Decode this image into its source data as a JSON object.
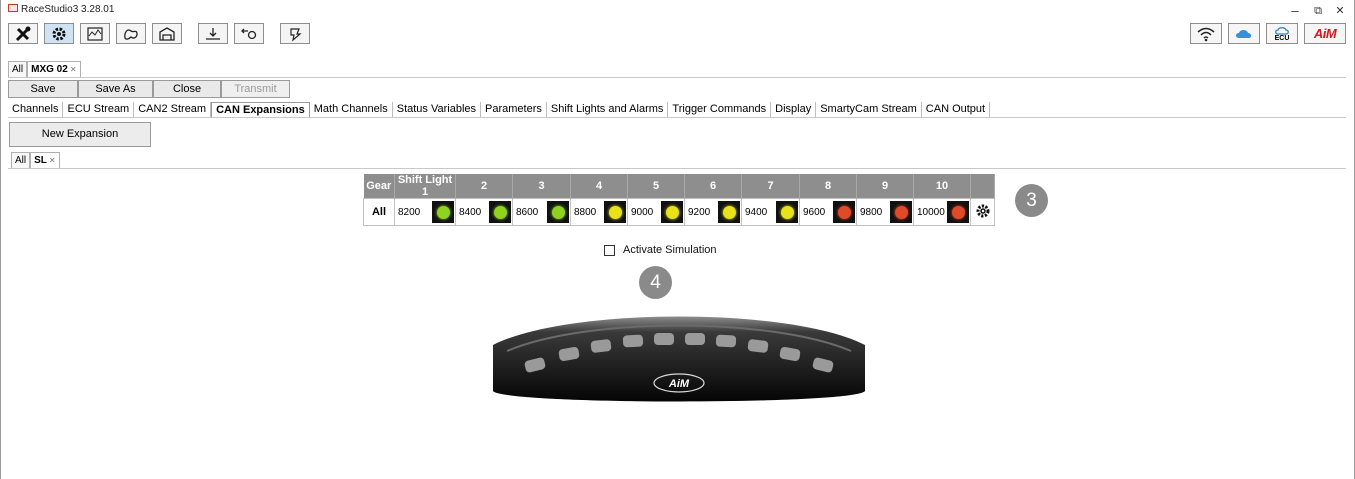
{
  "window": {
    "title": "RaceStudio3 3.28.01",
    "minimize": "–",
    "restore": "⧉",
    "close": "✕"
  },
  "toolbar": {
    "icons": [
      "tools-icon",
      "config-gear-icon",
      "analysis-icon",
      "tracks-icon",
      "garage-icon",
      "download-icon",
      "transfer-icon",
      "firmware-icon"
    ],
    "right_icons": [
      "wifi-icon",
      "cloud-icon",
      "ecu-icon",
      "aim-logo"
    ],
    "ecu_label": "ECU",
    "aim_label": "AiM"
  },
  "device_tabs": {
    "all": "All",
    "current": "MXG 02"
  },
  "actions": {
    "save": "Save",
    "save_as": "Save As",
    "close": "Close",
    "transmit": "Transmit"
  },
  "subtabs": [
    "Channels",
    "ECU Stream",
    "CAN2 Stream",
    "CAN Expansions",
    "Math Channels",
    "Status Variables",
    "Parameters",
    "Shift Lights and Alarms",
    "Trigger Commands",
    "Display",
    "SmartyCam Stream",
    "CAN Output"
  ],
  "selected_subtab": "CAN Expansions",
  "new_expansion": "New Expansion",
  "expansion_tabs": {
    "all": "All",
    "current": "SL"
  },
  "shift_table": {
    "headers": [
      "Gear",
      "Shift Light 1",
      "2",
      "3",
      "4",
      "5",
      "6",
      "7",
      "8",
      "9",
      "10"
    ],
    "row_label": "All",
    "values": [
      "8200",
      "8400",
      "8600",
      "8800",
      "9000",
      "9200",
      "9400",
      "9600",
      "9800",
      "10000"
    ],
    "led_colors": [
      "#8fd31e",
      "#8fd31e",
      "#8fd31e",
      "#e8e21a",
      "#e8e21a",
      "#e8e21a",
      "#e8e21a",
      "#e04a2a",
      "#e04a2a",
      "#e04a2a"
    ]
  },
  "callouts": {
    "table": "3",
    "simulation": "4"
  },
  "simulation": {
    "label": "Activate Simulation"
  },
  "device": {
    "brand": "AiM"
  }
}
